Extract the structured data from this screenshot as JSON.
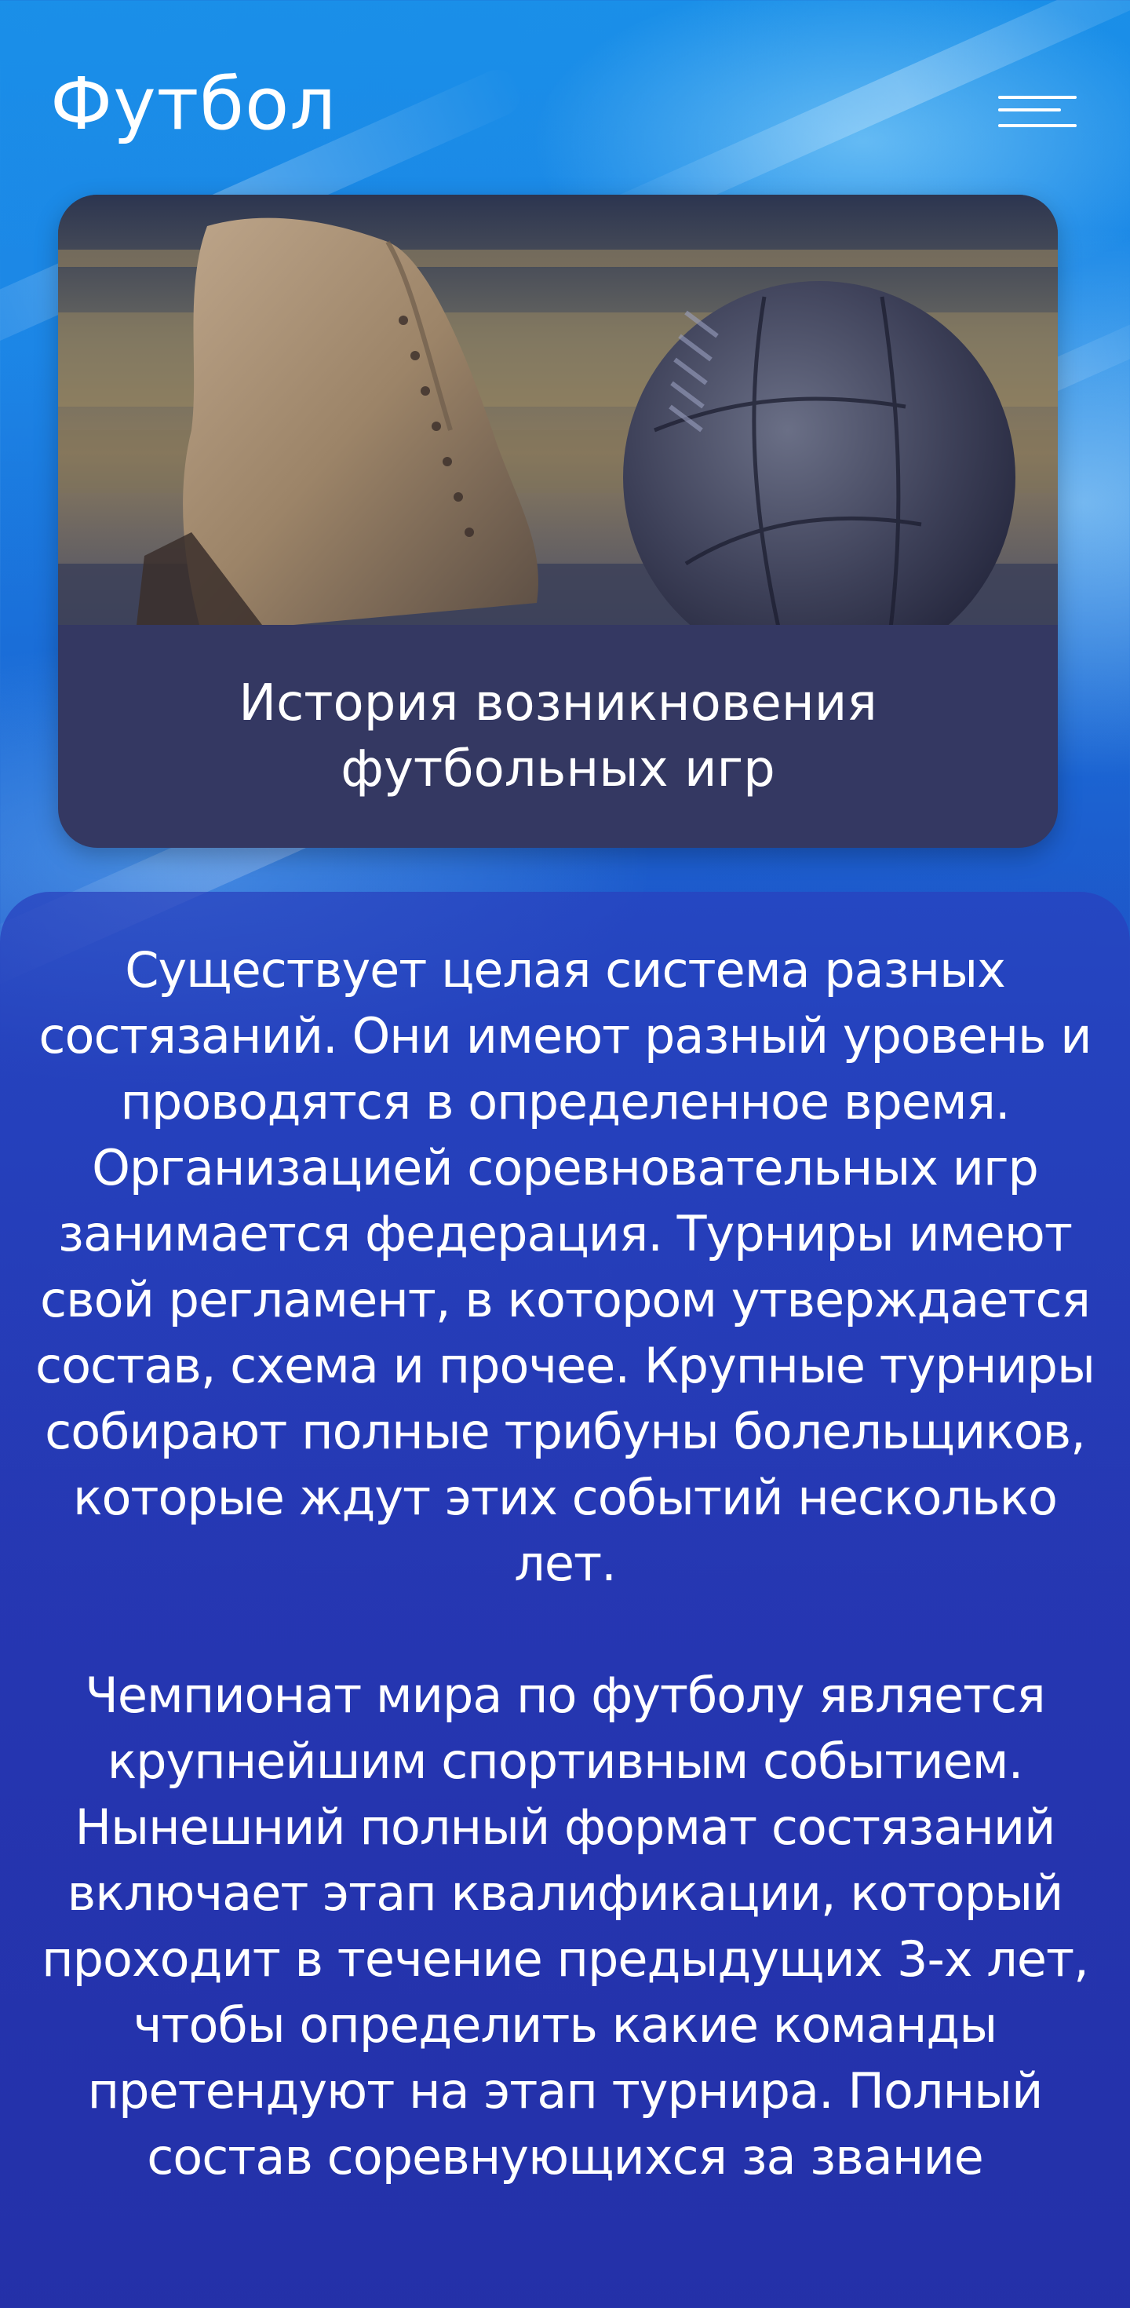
{
  "header": {
    "site_title": "Футбол",
    "menu_icon": "hamburger-menu-icon"
  },
  "feature_card": {
    "image_alt": "Старинные футбольные бутсы и кожаный мяч",
    "title": "История возникновения футбольных игр"
  },
  "article": {
    "paragraphs": [
      "Существует целая система разных состязаний. Они имеют разный уровень и проводятся в определенное время. Организацией соревновательных игр занимается федерация. Турниры имеют свой регламент, в котором утверждается состав, схема и прочее. Крупные турниры собирают полные трибуны болельщиков, которые ждут этих событий несколько лет.",
      "Чемпионат мира по футболу является крупнейшим спортивным событием. Нынешний полный формат состязаний включает этап квалификации, который проходит в течение предыдущих 3-х лет, чтобы определить какие команды претендуют на этап турнира. Полный состав соревнующихся за звание"
    ]
  },
  "colors": {
    "accent": "#1a8fe8",
    "card_caption_bg": "#343862",
    "panel_bg": "#2a3cb4",
    "text": "#ffffff"
  }
}
